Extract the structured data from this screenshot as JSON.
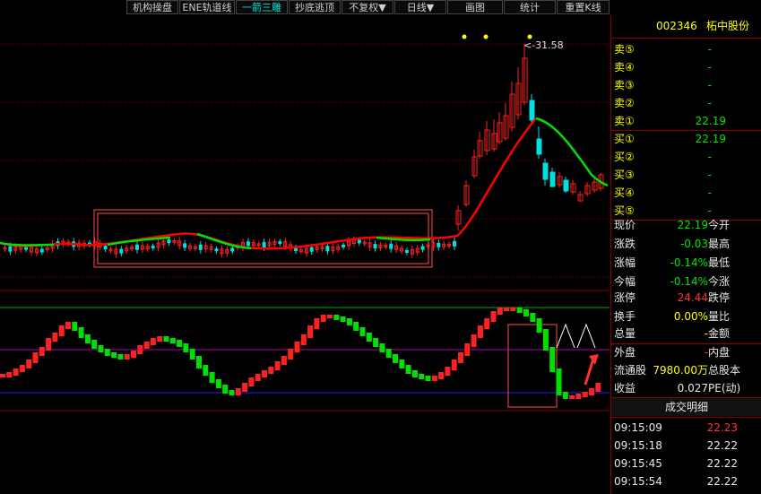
{
  "toolbar": {
    "buttons": [
      "机构操盘",
      "ENE轨道线",
      "一箭三雕",
      "抄底逃顶",
      "不复权▼",
      "日线▼",
      "画图",
      "统计",
      "重置K线"
    ]
  },
  "stock": {
    "code": "002346",
    "name": "柘中股份"
  },
  "chart": {
    "high_label": "<-31.58"
  },
  "order_book": {
    "sells": [
      {
        "label": "卖⑤",
        "price": "-"
      },
      {
        "label": "卖④",
        "price": "-"
      },
      {
        "label": "卖③",
        "price": "-"
      },
      {
        "label": "卖②",
        "price": "-"
      },
      {
        "label": "卖①",
        "price": "22.19"
      }
    ],
    "buys": [
      {
        "label": "买①",
        "price": "22.19"
      },
      {
        "label": "买②",
        "price": "-"
      },
      {
        "label": "买③",
        "price": "-"
      },
      {
        "label": "买④",
        "price": "-"
      },
      {
        "label": "买⑤",
        "price": "-"
      }
    ]
  },
  "quote": {
    "xianjia_label": "现价",
    "xianjia": "22.19",
    "jinkai_label": "今开",
    "zhangdie_label": "涨跌",
    "zhangdie": "-0.03",
    "zuigao_label": "最高",
    "zhangfu_label": "涨幅",
    "zhangfu": "-0.14%",
    "zuidi_label": "最低",
    "jinfu_label": "今幅",
    "jinfu": "-0.14%",
    "jinzhang_label": "今涨",
    "zhangting_label": "涨停",
    "zhangting": "24.44",
    "dieting_label": "跌停",
    "huanshou_label": "换手",
    "huanshou": "0.00%",
    "liangbi_label": "量比",
    "zongliang_label": "总量",
    "zongliang": "-",
    "jine_label": "金额",
    "waipan_label": "外盘",
    "waipan": "-",
    "neipan_label": "内盘",
    "liutong_label": "流通股",
    "liutong": "7980.00万",
    "zongguben_label": "总股本",
    "shouyi_label": "收益",
    "shouyi": "0.027",
    "pe_label": "PE(动)"
  },
  "trades": {
    "title": "成交明细",
    "rows": [
      {
        "time": "09:15:09",
        "price": "22.23"
      },
      {
        "time": "09:15:18",
        "price": "22.22"
      },
      {
        "time": "09:15:45",
        "price": "22.22"
      },
      {
        "time": "09:15:54",
        "price": "22.22"
      }
    ]
  },
  "colors": {
    "up": "#ff2020",
    "down": "#00e0e0",
    "ma_red": "#ff0000",
    "ma_green": "#00e000",
    "grid": "#8b0000"
  }
}
